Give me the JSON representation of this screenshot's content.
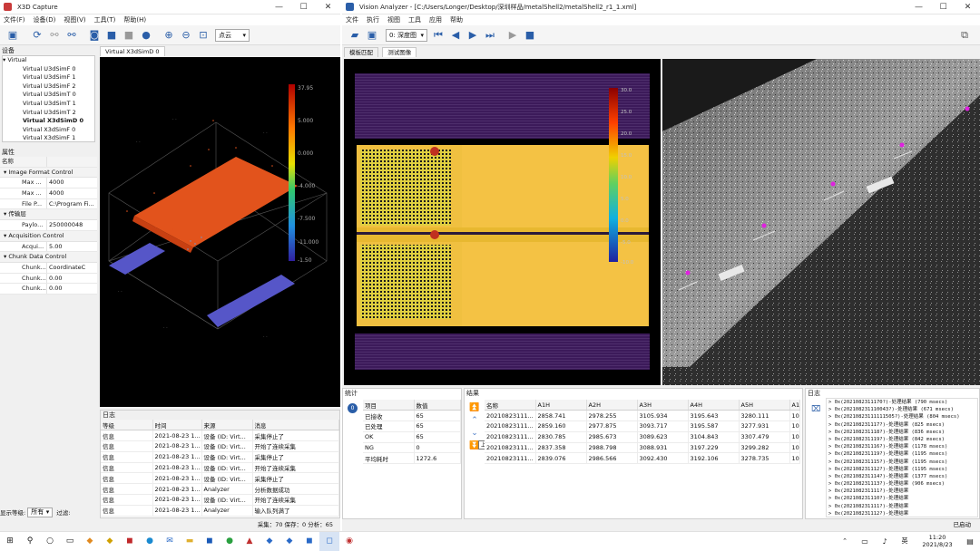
{
  "x3d": {
    "title": "X3D Capture",
    "menu": [
      "文件(F)",
      "设备(D)",
      "视图(V)",
      "工具(T)",
      "帮助(H)"
    ],
    "toolbar_combo": "点云",
    "device_panel_title": "设备",
    "tree_root": "Virtual",
    "devices": [
      "Virtual U3dSimF 0",
      "Virtual U3dSimF 1",
      "Virtual U3dSimF 2",
      "Virtual U3dSimT 0",
      "Virtual U3dSimT 1",
      "Virtual U3dSimT 2",
      "Virtual X3dSimD 0",
      "Virtual X3dSimF 0",
      "Virtual X3dSimF 1"
    ],
    "props_title": "属性",
    "props_header": "名称",
    "props": [
      {
        "type": "cat",
        "label": "Image Format Control"
      },
      {
        "type": "row",
        "k": "Max ...",
        "v": "4000"
      },
      {
        "type": "row",
        "k": "Max ...",
        "v": "4000"
      },
      {
        "type": "row",
        "k": "File P...",
        "v": "C:\\Program Fi..."
      },
      {
        "type": "cat",
        "label": "传输层"
      },
      {
        "type": "row",
        "k": "Paylo...",
        "v": "250000048"
      },
      {
        "type": "cat",
        "label": "Acquisition Control"
      },
      {
        "type": "row",
        "k": "Acqui...",
        "v": "5.00"
      },
      {
        "type": "cat",
        "label": "Chunk Data Control"
      },
      {
        "type": "row",
        "k": "Chunk...",
        "v": "CoordinateC"
      },
      {
        "type": "row",
        "k": "Chunk...",
        "v": "0.00"
      },
      {
        "type": "row",
        "k": "Chunk...",
        "v": "0.00"
      }
    ],
    "display_label": "显示等级:",
    "display_value": "所有",
    "filter_label": "过滤:",
    "view_tab": "Virtual X3dSimD 0",
    "scale_top": "37.95",
    "scale_bottom": "-1.50",
    "scale_ticks": [
      "5.000",
      "0.000",
      "-4.000",
      "-7.500",
      "-11.000"
    ],
    "log_title": "日志",
    "log_headers": [
      "等级",
      "时间",
      "来源",
      "消息"
    ],
    "log_rows": [
      [
        "信息",
        "2021-08-23 1...",
        "设备 (ID: Virt...",
        "采集停止了"
      ],
      [
        "信息",
        "2021-08-23 1...",
        "设备 (ID: Virt...",
        "开始了连续采集"
      ],
      [
        "信息",
        "2021-08-23 1...",
        "设备 (ID: Virt...",
        "采集停止了"
      ],
      [
        "信息",
        "2021-08-23 1...",
        "设备 (ID: Virt...",
        "开始了连续采集"
      ],
      [
        "信息",
        "2021-08-23 1...",
        "设备 (ID: Virt...",
        "采集停止了"
      ],
      [
        "信息",
        "2021-08-23 1...",
        "Analyzer",
        "分析数据成功"
      ],
      [
        "信息",
        "2021-08-23 1...",
        "设备 (ID: Virt...",
        "开始了连续采集"
      ],
      [
        "信息",
        "2021-08-23 1...",
        "Analyzer",
        "输入队列满了"
      ]
    ],
    "status": "采集：70  保存：0  分析：65"
  },
  "va": {
    "title": "Vision Analyzer - [C:/Users/Longer/Desktop/深圳样品/metalShell2/metalShell2_r1_1.xml]",
    "menu": [
      "文件",
      "执行",
      "视图",
      "工具",
      "应用",
      "帮助"
    ],
    "combo": "0: 深度图",
    "tabs": [
      "模板匹配",
      "测试图像"
    ],
    "depth_ticks": [
      "30.0",
      "25.0",
      "20.0",
      "15.0",
      "10.0",
      "5.0",
      "0.0",
      "-5.0",
      "-10.0"
    ],
    "stats_title": "统计",
    "stats_headers": [
      "项目",
      "数值"
    ],
    "stats_rows": [
      [
        "已接收",
        "65"
      ],
      [
        "已处理",
        "65"
      ],
      [
        "OK",
        "65"
      ],
      [
        "NG",
        "0"
      ],
      [
        "平均耗时",
        "1272.6"
      ]
    ],
    "stats_badge": "0",
    "results_title": "结果",
    "results_headers": [
      "名称",
      "A1H",
      "A2H",
      "A3H",
      "A4H",
      "A5H",
      "A1..."
    ],
    "results_rows": [
      [
        "20210823111...",
        "2858.741",
        "2978.255",
        "3105.934",
        "3195.643",
        "3280.111",
        "10..."
      ],
      [
        "20210823111...",
        "2859.160",
        "2977.875",
        "3093.717",
        "3195.587",
        "3277.931",
        "10..."
      ],
      [
        "20210823111...",
        "2830.785",
        "2985.673",
        "3089.623",
        "3104.843",
        "3307.479",
        "10..."
      ],
      [
        "20210823111...",
        "2837.358",
        "2988.798",
        "3088.931",
        "3197.229",
        "3299.282",
        "10..."
      ],
      [
        "20210823111...",
        "2839.076",
        "2986.566",
        "3092.430",
        "3192.106",
        "3278.735",
        "10..."
      ]
    ],
    "tooltip_up": "上移",
    "log_title": "日志",
    "log_lines": [
      "> 0x(2021082311170?)-处理结果 (790 msecs)",
      "> 0x(202108231110043?)-处理结果 (671 msecs)",
      "> 0x(20210823111111505?)-处理结果 (804 msecs)",
      "> 0x(202108231117?)-处理结果 (825 msecs)",
      "> 0x(202108231118?)-处理结果 (836 msecs)",
      "> 0x(202108231119?)-处理结果 (842 msecs)",
      "> 0x(202108231116?)-处理结果 (1178 msecs)",
      "> 0x(202108231119?)-处理结果 (1195 msecs)",
      "> 0x(202108231115?)-处理结果 (1195 msecs)",
      "> 0x(202108231112?)-处理结果 (1195 msecs)",
      "> 0x(202108231114?)-处理结果 (1377 msecs)",
      "> 0x(202108231113?)-处理结果 (906 msecs)",
      "> 0x(202108231111?)-处理结果",
      "> 0x(202108231110?)-处理结果",
      "> 0x(202108231111?)-处理结果",
      "> 0x(202108231112?)-处理结果"
    ],
    "status_right": "已启动"
  },
  "taskbar": {
    "time": "11:20",
    "date": "2021/8/23",
    "lang": "英"
  },
  "colors": {
    "accent": "#2a5ea8",
    "orange": "#e2531c",
    "blue": "#5656c8",
    "dark": "#000000",
    "purple": "#3c1a5a"
  }
}
